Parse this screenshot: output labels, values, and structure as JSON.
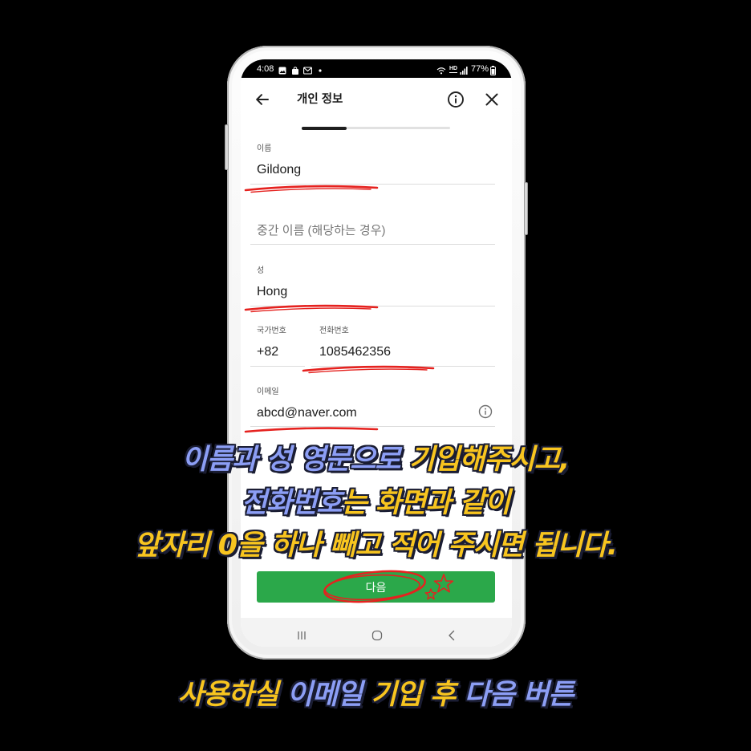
{
  "status_bar": {
    "time": "4:08",
    "volte_label": "HD",
    "battery": "77%",
    "left_icons": [
      "gallery-icon",
      "shopping-bag-icon",
      "gmail-icon",
      "notification-dot-icon"
    ],
    "right_icons": [
      "wifi-calling-icon",
      "volte-icon",
      "signal-icon",
      "battery-icon"
    ]
  },
  "header": {
    "title": "개인 정보",
    "back_icon": "arrow-left-icon",
    "info_icon": "info-icon",
    "close_icon": "close-icon"
  },
  "progress": {
    "fraction": 0.3
  },
  "form": {
    "first_name": {
      "label": "이름",
      "value": "Gildong"
    },
    "middle_name": {
      "placeholder": "중간 이름 (해당하는 경우)"
    },
    "last_name": {
      "label": "성",
      "value": "Hong"
    },
    "country_code": {
      "label": "국가번호",
      "value": "+82"
    },
    "phone": {
      "label": "전화번호",
      "value": "1085462356"
    },
    "email": {
      "label": "이메일",
      "value": "abcd@naver.com",
      "info_icon": "info-icon"
    }
  },
  "next_button": {
    "label": "다음"
  },
  "nav_bar": {
    "icons": [
      "recent-apps-icon",
      "home-icon",
      "back-icon"
    ]
  },
  "captions": {
    "line1": [
      {
        "text": "이름과 성 영문으로",
        "color": "#8c9ef5"
      },
      {
        "text": " 기입해주시고,",
        "color": "#f8c51f"
      }
    ],
    "line2": [
      {
        "text": "전화번호",
        "color": "#8c9ef5"
      },
      {
        "text": "는 화면과 같이",
        "color": "#f8c51f"
      }
    ],
    "line3": [
      {
        "text": "앞자리 0을 하나 빼고 적어 주시면 됩니다.",
        "color": "#f8c51f"
      }
    ],
    "bottom": [
      {
        "text": "사용하실",
        "color": "#f8c51f"
      },
      {
        "text": " 이메일",
        "color": "#8c9ef5"
      },
      {
        "text": " 기입 후",
        "color": "#f8c51f"
      },
      {
        "text": " 다음 버튼",
        "color": "#8c9ef5"
      }
    ]
  },
  "colors": {
    "background": "#000000",
    "accent_green": "#2ba84a",
    "annotation_red": "#e5221f",
    "caption_outline": "#1a1d33"
  }
}
